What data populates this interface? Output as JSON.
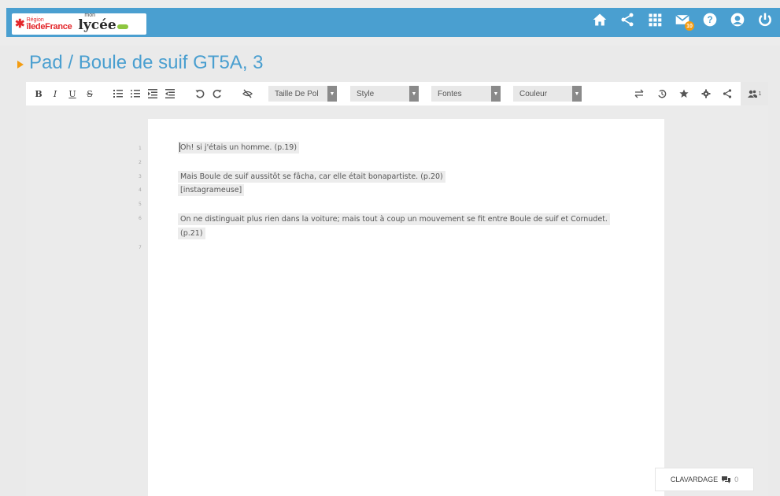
{
  "header": {
    "logo_region_small": "Région",
    "logo_region_big": "îledeFrance",
    "logo_mon": "mon",
    "logo_lycee": "lycée",
    "mail_badge": "10"
  },
  "page": {
    "title": "Pad / Boule de suif GT5A, 3"
  },
  "toolbar": {
    "bold": "B",
    "italic": "I",
    "underline": "U",
    "strike": "S",
    "font_size_select": "Taille De Pol",
    "style_select": "Style",
    "fonts_select": "Fontes",
    "color_select": "Couleur",
    "users_count": "1"
  },
  "editor": {
    "line_numbers": [
      "1",
      "2",
      "3",
      "4",
      "5",
      "6",
      "7"
    ],
    "lines": [
      "Oh! si j'étais un homme. (p.19)",
      "Mais Boule de suif aussitôt se fâcha, car elle était bonapartiste. (p.20)",
      "[instagrameuse]",
      "On ne distinguait plus rien dans la voiture; mais tout à coup un mouvement se fit entre Boule de suif et Cornudet.",
      "(p.21)"
    ]
  },
  "chat": {
    "label": "CLAVARDAGE",
    "count": "0"
  },
  "colors": {
    "header_blue": "#4a9fd0",
    "accent_orange": "#f39c12"
  }
}
